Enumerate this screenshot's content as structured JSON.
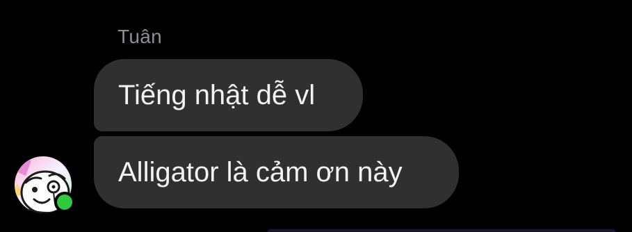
{
  "conversation": {
    "sender": {
      "name": "Tuân",
      "status": "online",
      "status_color": "#31c940"
    },
    "messages": [
      {
        "text": "Tiếng nhật dễ vl"
      },
      {
        "text": "Alligator là cảm ơn này"
      }
    ]
  },
  "theme": {
    "background": "#000000",
    "bubble_color": "#303030",
    "text_color": "#f2f2f2",
    "name_color": "#8e8e93"
  },
  "icons": {
    "avatar": "avatar-cartoon-face",
    "presence": "online-dot"
  }
}
